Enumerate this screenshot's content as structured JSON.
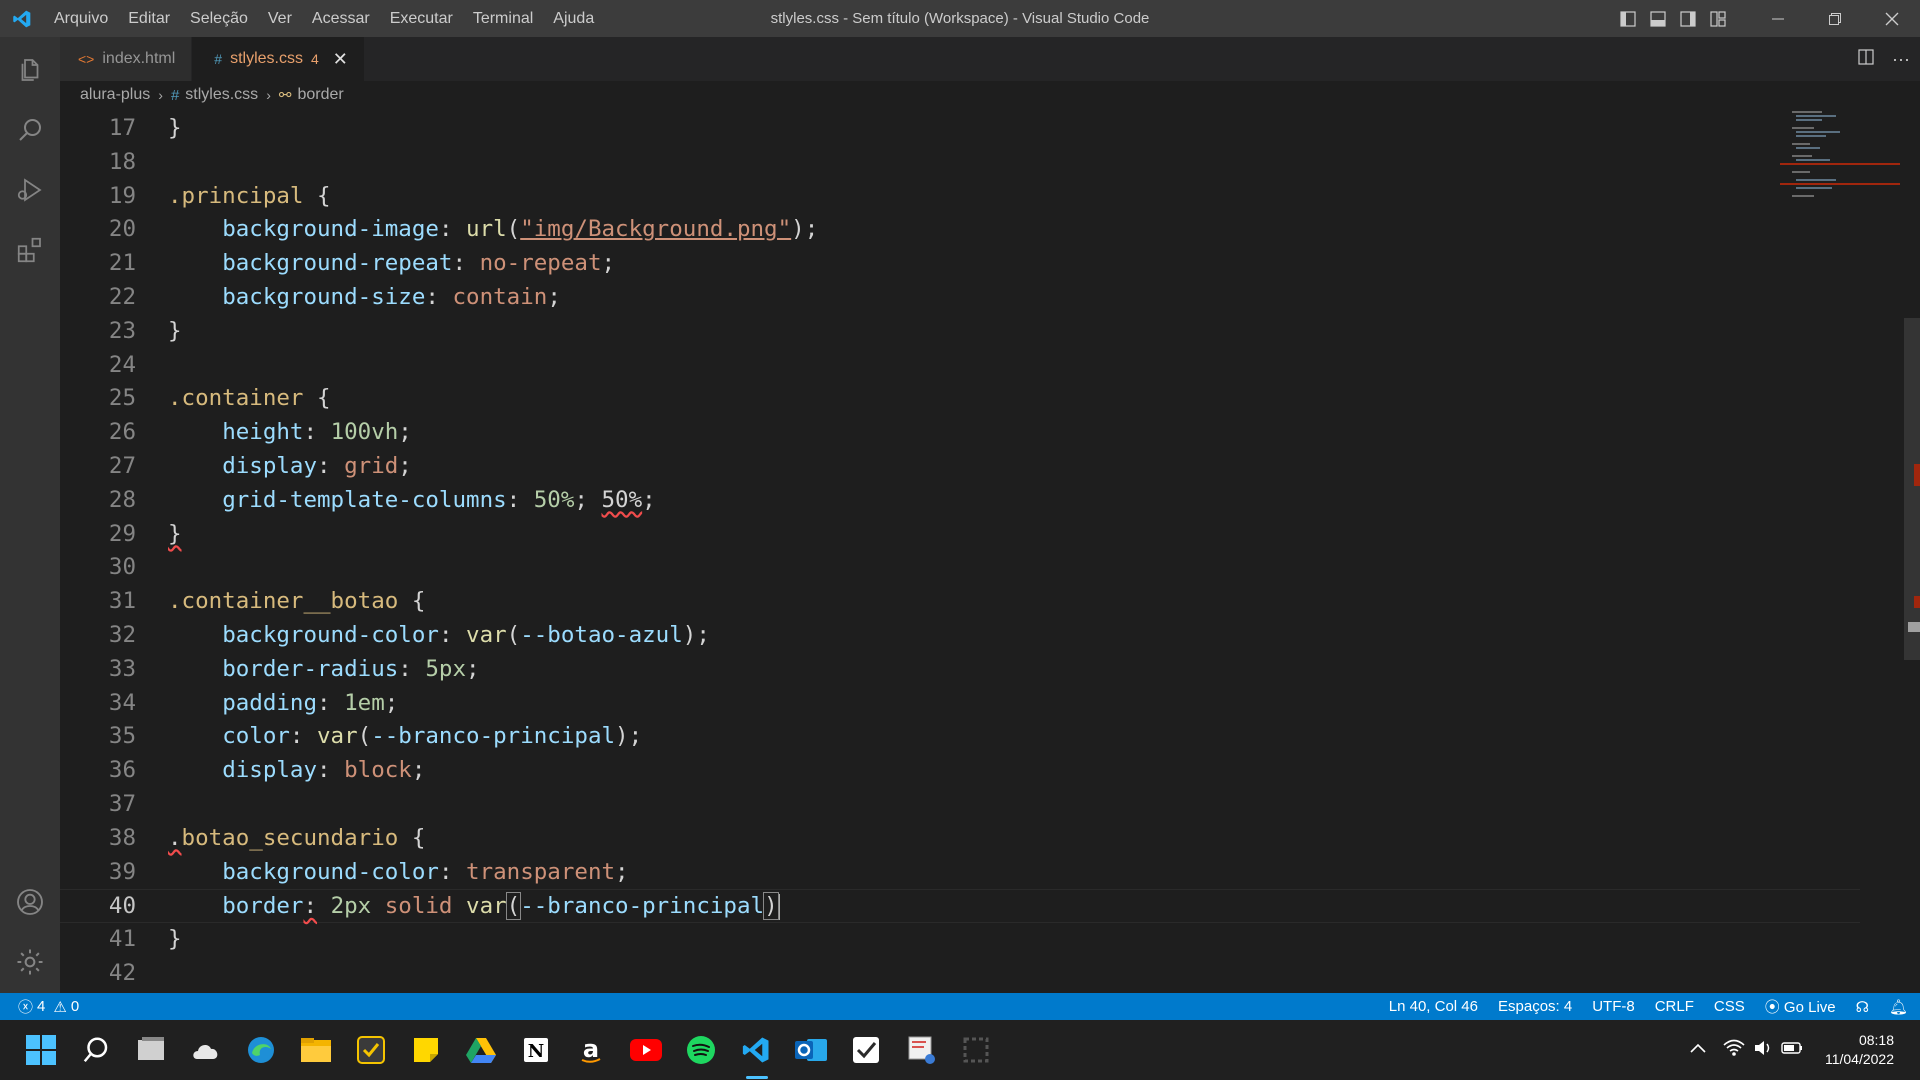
{
  "window": {
    "title": "stlyles.css - Sem título (Workspace) - Visual Studio Code",
    "menu": [
      "Arquivo",
      "Editar",
      "Seleção",
      "Ver",
      "Acessar",
      "Executar",
      "Terminal",
      "Ajuda"
    ]
  },
  "tabs": [
    {
      "label": "index.html",
      "icon": "html-code-icon",
      "active": false
    },
    {
      "label": "stlyles.css",
      "icon": "hash-icon",
      "active": true,
      "badge": "4"
    }
  ],
  "breadcrumb": {
    "folder": "alura-plus",
    "file": "stlyles.css",
    "symbol": "border"
  },
  "editor": {
    "lines": [
      {
        "n": "17",
        "text": "}"
      },
      {
        "n": "18",
        "text": ""
      },
      {
        "n": "19",
        "text": ".principal {"
      },
      {
        "n": "20",
        "text": "    background-image: url(\"img/Background.png\");"
      },
      {
        "n": "21",
        "text": "    background-repeat: no-repeat;"
      },
      {
        "n": "22",
        "text": "    background-size: contain;"
      },
      {
        "n": "23",
        "text": "}"
      },
      {
        "n": "24",
        "text": ""
      },
      {
        "n": "25",
        "text": ".container {"
      },
      {
        "n": "26",
        "text": "    height: 100vh;"
      },
      {
        "n": "27",
        "text": "    display: grid;"
      },
      {
        "n": "28",
        "text": "    grid-template-columns: 50%; 50%;"
      },
      {
        "n": "29",
        "text": "}"
      },
      {
        "n": "30",
        "text": ""
      },
      {
        "n": "31",
        "text": ".container__botao {"
      },
      {
        "n": "32",
        "text": "    background-color: var(--botao-azul);"
      },
      {
        "n": "33",
        "text": "    border-radius: 5px;"
      },
      {
        "n": "34",
        "text": "    padding: 1em;"
      },
      {
        "n": "35",
        "text": "    color: var(--branco-principal);"
      },
      {
        "n": "36",
        "text": "    display: block;"
      },
      {
        "n": "37",
        "text": ""
      },
      {
        "n": "38",
        "text": ".botao_secundario {"
      },
      {
        "n": "39",
        "text": "    background-color: transparent;"
      },
      {
        "n": "40",
        "text": "    border: 2px solid var(--branco-principal)"
      },
      {
        "n": "41",
        "text": "}"
      },
      {
        "n": "42",
        "text": ""
      }
    ],
    "current_line": "40"
  },
  "statusbar": {
    "errors": "4",
    "warnings": "0",
    "position": "Ln 40, Col 46",
    "spaces": "Espaços: 4",
    "encoding": "UTF-8",
    "eol": "CRLF",
    "language": "CSS",
    "golive": "Go Live"
  },
  "taskbar": {
    "apps": [
      "windows-start-icon",
      "search-icon",
      "task-view-icon",
      "onedrive-icon",
      "edge-icon",
      "file-explorer-icon",
      "norton-icon",
      "sticky-notes-icon",
      "google-drive-icon",
      "notion-icon",
      "amazon-icon",
      "youtube-icon",
      "spotify-icon",
      "vscode-icon",
      "outlook-icon",
      "todo-icon",
      "snipping-tool-icon",
      "app-icon"
    ],
    "time": "08:18",
    "date": "11/04/2022"
  },
  "colors": {
    "accent": "#007acc",
    "selector": "#d7ba7d",
    "property": "#9cdcfe",
    "value": "#ce9178",
    "number": "#b5cea8",
    "function": "#dcdcaa"
  }
}
